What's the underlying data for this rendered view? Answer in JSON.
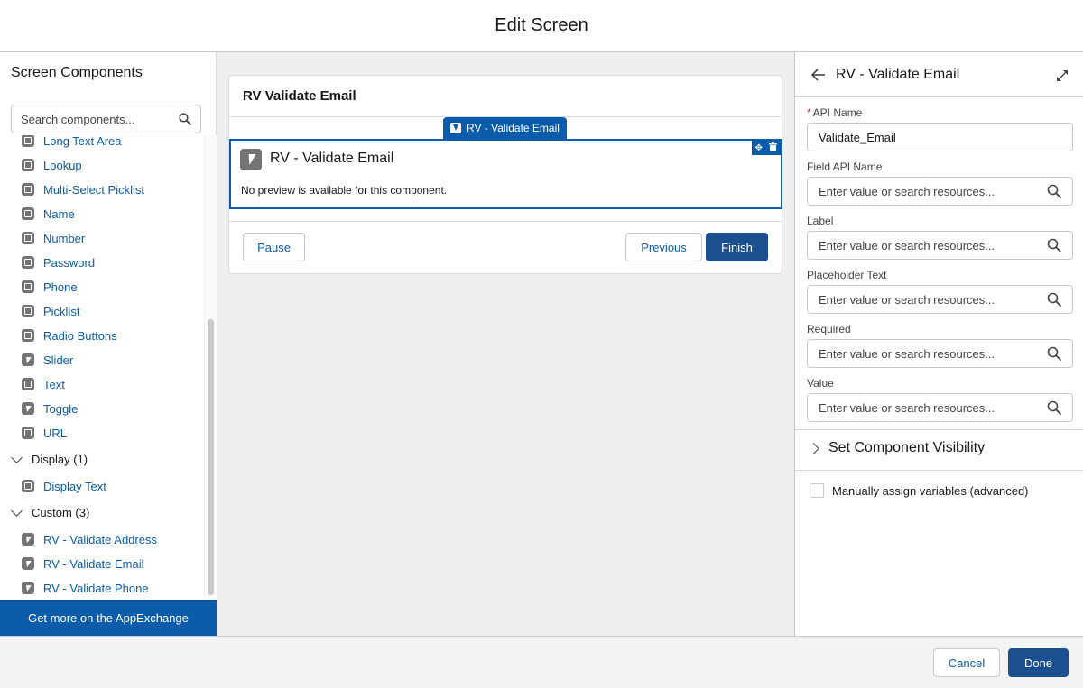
{
  "modal": {
    "title": "Edit Screen"
  },
  "left_panel": {
    "title": "Screen Components",
    "search_placeholder": "Search components...",
    "items": [
      {
        "label": "Long Text Area",
        "icon": "textarea-icon"
      },
      {
        "label": "Lookup",
        "icon": "lookup-icon"
      },
      {
        "label": "Multi-Select Picklist",
        "icon": "multi-picklist-icon"
      },
      {
        "label": "Name",
        "icon": "name-icon"
      },
      {
        "label": "Number",
        "icon": "number-icon"
      },
      {
        "label": "Password",
        "icon": "password-icon"
      },
      {
        "label": "Phone",
        "icon": "phone-icon"
      },
      {
        "label": "Picklist",
        "icon": "picklist-icon"
      },
      {
        "label": "Radio Buttons",
        "icon": "radio-icon"
      },
      {
        "label": "Slider",
        "icon": "bolt-icon"
      },
      {
        "label": "Text",
        "icon": "text-icon"
      },
      {
        "label": "Toggle",
        "icon": "bolt-icon"
      },
      {
        "label": "URL",
        "icon": "link-icon"
      }
    ],
    "sections": [
      {
        "label": "Display (1)",
        "items": [
          {
            "label": "Display Text",
            "icon": "display-text-icon"
          }
        ]
      },
      {
        "label": "Custom (3)",
        "items": [
          {
            "label": "RV - Validate Address",
            "icon": "bolt-icon"
          },
          {
            "label": "RV - Validate Email",
            "icon": "bolt-icon"
          },
          {
            "label": "RV - Validate Phone",
            "icon": "bolt-icon"
          }
        ]
      }
    ],
    "appexchange_label": "Get more on the AppExchange"
  },
  "canvas": {
    "screen_title": "RV Validate Email",
    "tab_label": "RV - Validate Email",
    "component_name": "RV - Validate Email",
    "component_note": "No preview is available for this component.",
    "pause_label": "Pause",
    "previous_label": "Previous",
    "finish_label": "Finish"
  },
  "right_panel": {
    "title": "RV - Validate Email",
    "api_name_label": "API Name",
    "api_name_value": "Validate_Email",
    "fields": [
      {
        "label": "Field API Name",
        "placeholder": "Enter value or search resources..."
      },
      {
        "label": "Label",
        "placeholder": "Enter value or search resources..."
      },
      {
        "label": "Placeholder Text",
        "placeholder": "Enter value or search resources..."
      },
      {
        "label": "Required",
        "placeholder": "Enter value or search resources..."
      },
      {
        "label": "Value",
        "placeholder": "Enter value or search resources..."
      }
    ],
    "visibility_label": "Set Component Visibility",
    "manual_assign_label": "Manually assign variables (advanced)"
  },
  "footer": {
    "cancel_label": "Cancel",
    "done_label": "Done"
  },
  "colors": {
    "brand": "#0b5cab",
    "brand_dark": "#1b4f8f",
    "required": "#c23934"
  }
}
